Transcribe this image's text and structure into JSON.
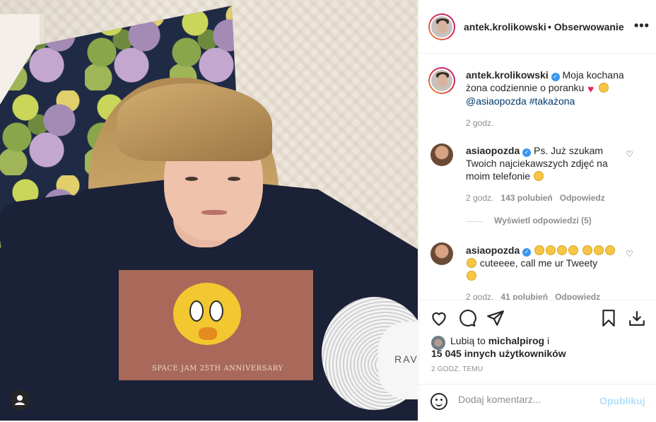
{
  "post": {
    "author": "antek.krolikowski",
    "separator": " • ",
    "follow_status": "Obserwowanie",
    "more_icon": "more-horizontal-icon",
    "caption_text": "Moja kochana żona codziennie o poranku",
    "caption_tags": "@asiaopozda #takażona",
    "caption_time": "2 godz.",
    "photo_print_text": "SPACE JAM 25TH ANNIVERSARY",
    "fan_label": "RAVI"
  },
  "comments": [
    {
      "user": "asiaopozda",
      "text": "Ps. Już szukam Twoich najciekawszych zdjęć na moim telefonie",
      "time": "2 godz.",
      "likes": "143 polubień",
      "reply": "Odpowiedz",
      "view_replies": "Wyświetl odpowiedzi (5)"
    },
    {
      "user": "asiaopozda",
      "text": "cuteeee, call me ur Tweety",
      "time": "2 godz.",
      "likes": "41 polubień",
      "reply": "Odpowiedz"
    }
  ],
  "actions": {
    "icons": [
      "heart-icon",
      "comment-icon",
      "share-icon",
      "bookmark-icon",
      "download-icon"
    ],
    "liked_by_prefix": "Lubią to",
    "liked_by_user": "michalpirog",
    "liked_by_suffix": "i",
    "others": "15 045 innych użytkowników",
    "time_ago": "2 GODZ. TEMU"
  },
  "add_comment": {
    "placeholder": "Dodaj komentarz...",
    "publish": "Opublikuj"
  },
  "colors": {
    "verified": "#3897f0",
    "publish_disabled": "#b2dffc",
    "meta": "#8e8e8e"
  }
}
